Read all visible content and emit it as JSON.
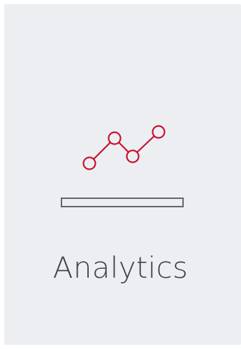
{
  "card": {
    "title": "Analytics",
    "icon": "line-chart-icon"
  },
  "colors": {
    "card_background": "#eceef2",
    "accent": "#c8102e",
    "bar_outline": "#5d666e",
    "title_text": "#3e4449"
  }
}
